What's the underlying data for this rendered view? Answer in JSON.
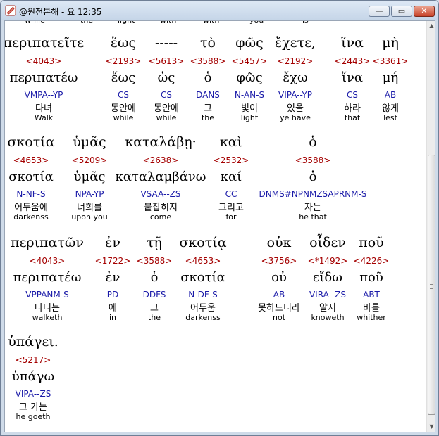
{
  "window": {
    "title": "@원전본해 - 요 12:35",
    "buttons": {
      "minimize": "—",
      "maximize": "▭",
      "close": "✕"
    }
  },
  "top_cut_words": [
    "while",
    "the",
    "light",
    "with",
    "with",
    "you",
    "is"
  ],
  "rows": [
    {
      "words": [
        {
          "greek": "περιπατεῖτε",
          "strong": "<4043>",
          "lemma": "περιπατέω",
          "morph": "VMPA--YP",
          "korean": "다녀",
          "english": "Walk"
        },
        {
          "greek": "ἕως",
          "strong": "<2193>",
          "lemma": "ἕως",
          "morph": "CS",
          "korean": "동안에",
          "english": "while"
        },
        {
          "greek": "-----",
          "strong": "<5613>",
          "lemma": "ὡς",
          "morph": "CS",
          "korean": "동안에",
          "english": "while"
        },
        {
          "greek": "τὸ",
          "strong": "<3588>",
          "lemma": "ὁ",
          "morph": "DANS",
          "korean": "그",
          "english": "the"
        },
        {
          "greek": "φῶς",
          "strong": "<5457>",
          "lemma": "φῶς",
          "morph": "N-AN-S",
          "korean": "빛이",
          "english": "light"
        },
        {
          "greek": "ἔχετε,",
          "strong": "<2192>",
          "lemma": "ἔχω",
          "morph": "VIPA--YP",
          "korean": "있을",
          "english": "ye have"
        },
        {
          "greek": "ἵνα",
          "strong": "<2443>",
          "lemma": "ἵνα",
          "morph": "CS",
          "korean": "하라",
          "english": "that"
        },
        {
          "greek": "μὴ",
          "strong": "<3361>",
          "lemma": "μή",
          "morph": "AB",
          "korean": "않게",
          "english": "lest"
        }
      ]
    },
    {
      "words": [
        {
          "greek": "σκοτία",
          "strong": "<4653>",
          "lemma": "σκοτία",
          "morph": "N-NF-S",
          "korean": "어두움에",
          "english": "darkenss"
        },
        {
          "greek": "ὑμᾶς",
          "strong": "<5209>",
          "lemma": "ὑμᾶς",
          "morph": "NPA-YP",
          "korean": "너희를",
          "english": "upon you"
        },
        {
          "greek": "καταλάβῃ·",
          "strong": "<2638>",
          "lemma": "καταλαμβάνω",
          "morph": "VSAA--ZS",
          "korean": "붙잡히지",
          "english": "come"
        },
        {
          "greek": "καὶ",
          "strong": "<2532>",
          "lemma": "καί",
          "morph": "CC",
          "korean": "그리고",
          "english": "for"
        },
        {
          "greek": "ὁ",
          "strong": "<3588>",
          "lemma": "ὁ",
          "morph": "DNMS#NPNMZSAPRNM-S",
          "korean": "자는",
          "english": "he that"
        }
      ]
    },
    {
      "words": [
        {
          "greek": "περιπατῶν",
          "strong": "<4043>",
          "lemma": "περιπατέω",
          "morph": "VPPANM-S",
          "korean": "다니는",
          "english": "walketh"
        },
        {
          "greek": "ἐν",
          "strong": "<1722>",
          "lemma": "ἐν",
          "morph": "PD",
          "korean": "에",
          "english": "in"
        },
        {
          "greek": "τῇ",
          "strong": "<3588>",
          "lemma": "ὁ",
          "morph": "DDFS",
          "korean": "그",
          "english": "the"
        },
        {
          "greek": "σκοτίᾳ",
          "strong": "<4653>",
          "lemma": "σκοτία",
          "morph": "N-DF-S",
          "korean": "어두움",
          "english": "darkenss"
        },
        {
          "greek": "οὐκ",
          "strong": "<3756>",
          "lemma": "οὐ",
          "morph": "AB",
          "korean": "못하느니라",
          "english": "not"
        },
        {
          "greek": "οἶδεν",
          "strong": "<*1492>",
          "lemma": "εἴδω",
          "morph": "VIRA--ZS",
          "korean": "알지",
          "english": "knoweth"
        },
        {
          "greek": "ποῦ",
          "strong": "<4226>",
          "lemma": "ποῦ",
          "morph": "ABT",
          "korean": "바를",
          "english": "whither"
        }
      ]
    },
    {
      "words": [
        {
          "greek": "ὑπάγει.",
          "strong": "<5217>",
          "lemma": "ὑπάγω",
          "morph": "VIPA--ZS",
          "korean": "그 가는",
          "english": "he goeth"
        }
      ]
    }
  ]
}
